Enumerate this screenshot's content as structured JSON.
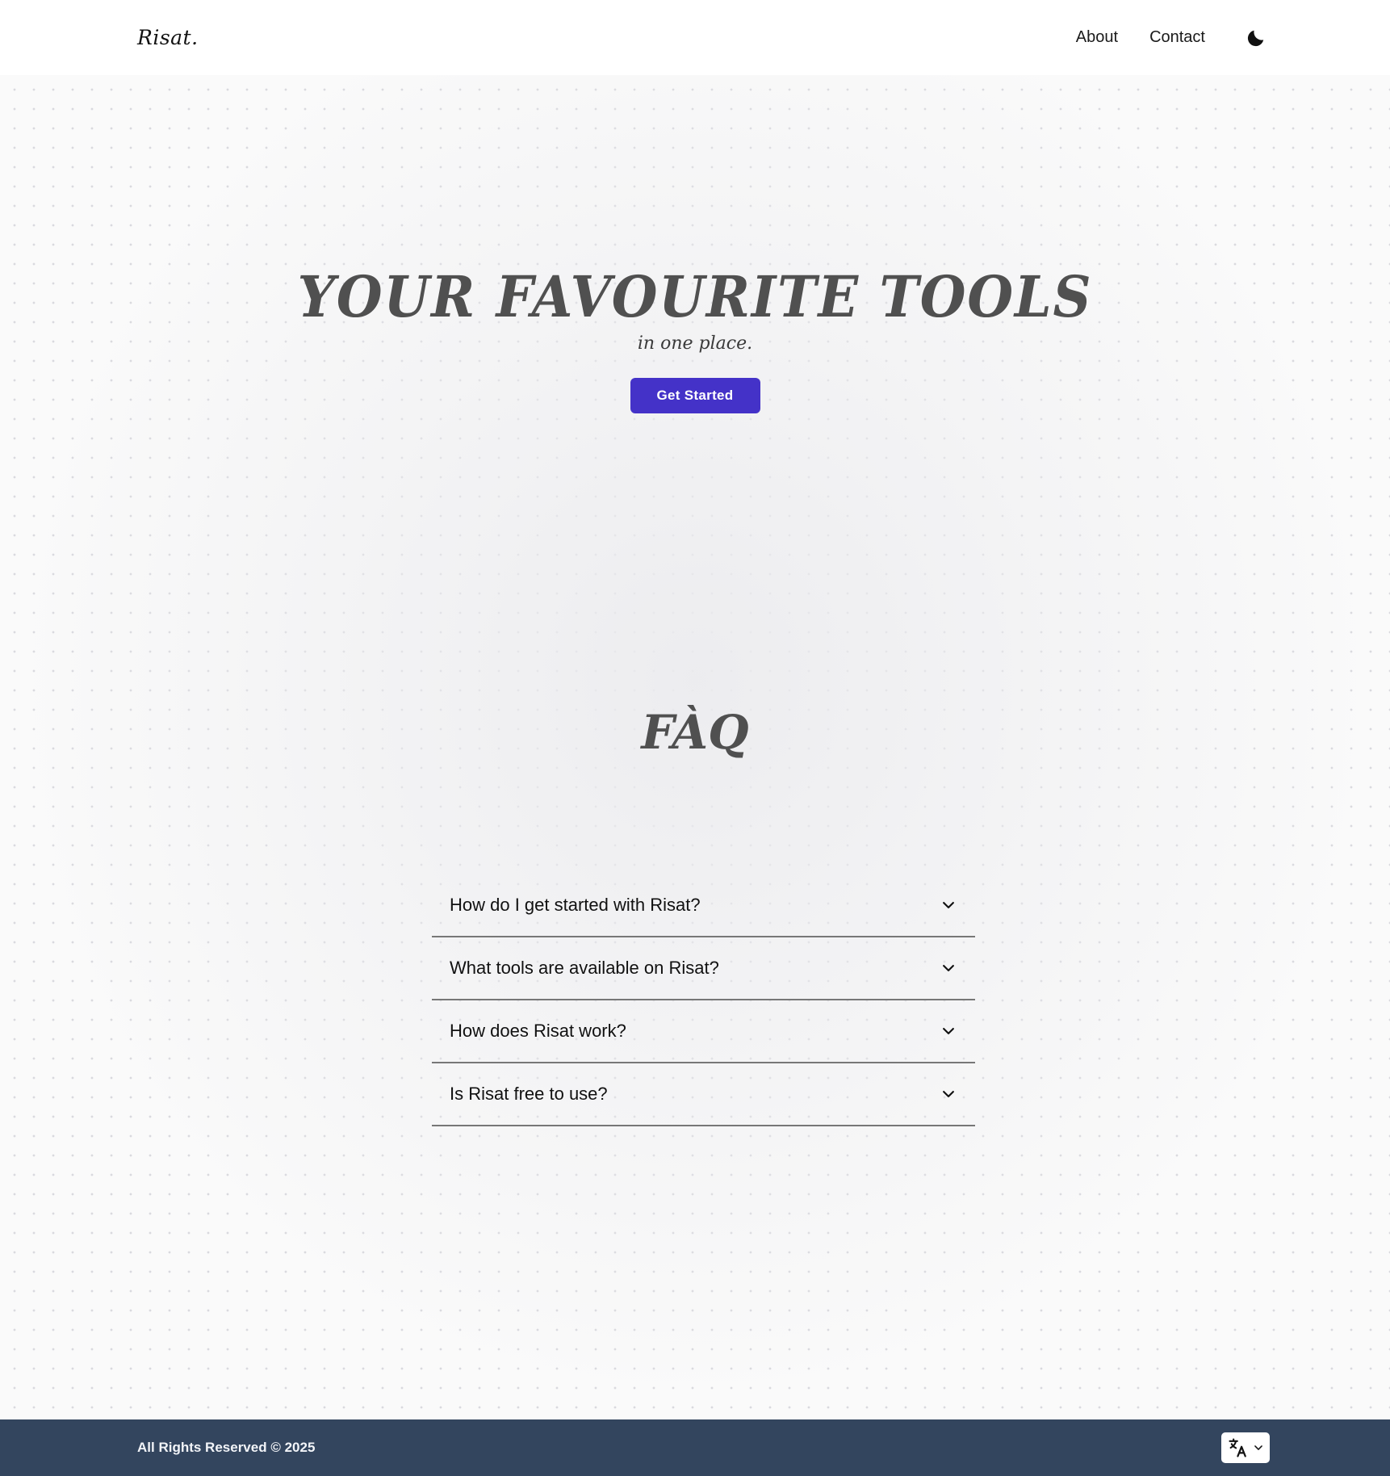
{
  "brand": {
    "logo": "Risat."
  },
  "nav": {
    "about": "About",
    "contact": "Contact",
    "theme_icon": "moon-icon"
  },
  "hero": {
    "title": "YOUR FAVOURITE TOOLS",
    "subtitle": "in one place.",
    "cta": "Get Started",
    "cta_color": "#4432c8"
  },
  "faq": {
    "title": "FÀQ",
    "items": [
      {
        "question": "How do I get started with Risat?"
      },
      {
        "question": "What tools are available on Risat?"
      },
      {
        "question": "How does Risat work?"
      },
      {
        "question": "Is Risat free to use?"
      }
    ]
  },
  "footer": {
    "copyright": "All Rights Reserved © 2025",
    "language_icon": "translate-icon",
    "background": "#33455e"
  }
}
